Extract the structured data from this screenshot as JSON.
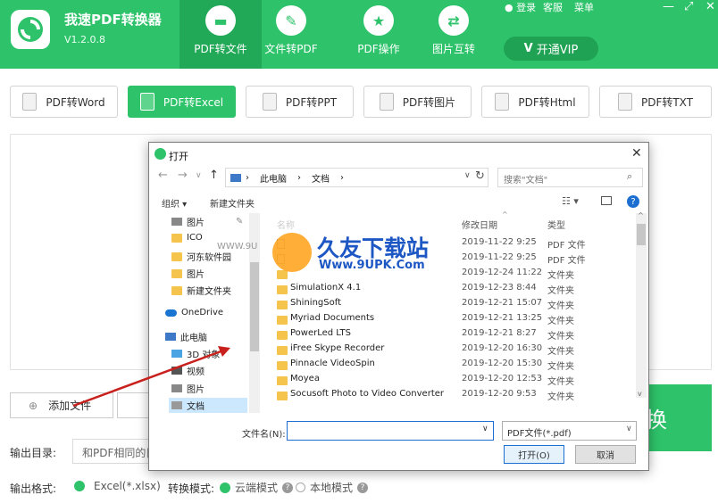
{
  "app": {
    "title": "我速PDF转换器",
    "version": "V1.2.0.8"
  },
  "top_links": {
    "login": "登录",
    "support": "客服",
    "menu": "菜单"
  },
  "nav": [
    {
      "label": "PDF转文件",
      "icon": "folder-icon"
    },
    {
      "label": "文件转PDF",
      "icon": "pdf-icon"
    },
    {
      "label": "PDF操作",
      "icon": "star-icon"
    },
    {
      "label": "图片互转",
      "icon": "swap-icon"
    }
  ],
  "vip_label": "开通VIP",
  "sub_tabs": [
    "PDF转Word",
    "PDF转Excel",
    "PDF转PPT",
    "PDF转图片",
    "PDF转Html",
    "PDF转TXT"
  ],
  "selected_sub_tab": "PDF转Excel",
  "add_file_label": "添加文件",
  "convert_label": "换",
  "output": {
    "dir_label": "输出目录:",
    "dir_value": "和PDF相同的目",
    "format_label": "输出格式:",
    "format_value": "Excel(*.xlsx)",
    "mode_label": "转换模式:",
    "mode_cloud": "云端模式",
    "mode_local": "本地模式"
  },
  "dialog": {
    "title": "打开",
    "breadcrumb": [
      "此电脑",
      "文档"
    ],
    "search_placeholder": "搜索\"文档\"",
    "organize": "组织 ▾",
    "new_folder": "新建文件夹",
    "nav_items": [
      "图片",
      "ICO",
      "河东软件园",
      "图片",
      "新建文件夹",
      "OneDrive",
      "此电脑",
      "3D 对象",
      "视频",
      "图片",
      "文档"
    ],
    "col_name": "名称",
    "col_date": "修改日期",
    "col_type": "类型",
    "files": [
      {
        "name": "",
        "date": "2019-11-22 9:25",
        "type": "PDF 文件",
        "kind": "pdf"
      },
      {
        "name": "",
        "date": "2019-11-22 9:25",
        "type": "PDF 文件",
        "kind": "pdf"
      },
      {
        "name": "",
        "date": "2019-12-24 11:22",
        "type": "文件夹",
        "kind": "folder"
      },
      {
        "name": "SimulationX 4.1",
        "date": "2019-12-23 8:44",
        "type": "文件夹",
        "kind": "folder"
      },
      {
        "name": "ShiningSoft",
        "date": "2019-12-21 15:07",
        "type": "文件夹",
        "kind": "folder"
      },
      {
        "name": "Myriad Documents",
        "date": "2019-12-21 13:25",
        "type": "文件夹",
        "kind": "folder"
      },
      {
        "name": "PowerLed LTS",
        "date": "2019-12-21 8:27",
        "type": "文件夹",
        "kind": "folder"
      },
      {
        "name": "iFree Skype Recorder",
        "date": "2019-12-20 16:30",
        "type": "文件夹",
        "kind": "folder"
      },
      {
        "name": "Pinnacle VideoSpin",
        "date": "2019-12-20 15:30",
        "type": "文件夹",
        "kind": "folder"
      },
      {
        "name": "Moyea",
        "date": "2019-12-20 12:53",
        "type": "文件夹",
        "kind": "folder"
      },
      {
        "name": "Socusoft Photo to Video Converter",
        "date": "2019-12-20 9:53",
        "type": "文件夹",
        "kind": "folder"
      }
    ],
    "filename_label": "文件名(N):",
    "filetype_value": "PDF文件(*.pdf)",
    "open_label": "打开(O)",
    "cancel_label": "取消"
  },
  "watermark": {
    "brand": "久友下载站",
    "url": "Www.9UPK.Com",
    "www": "WWW.9U"
  }
}
